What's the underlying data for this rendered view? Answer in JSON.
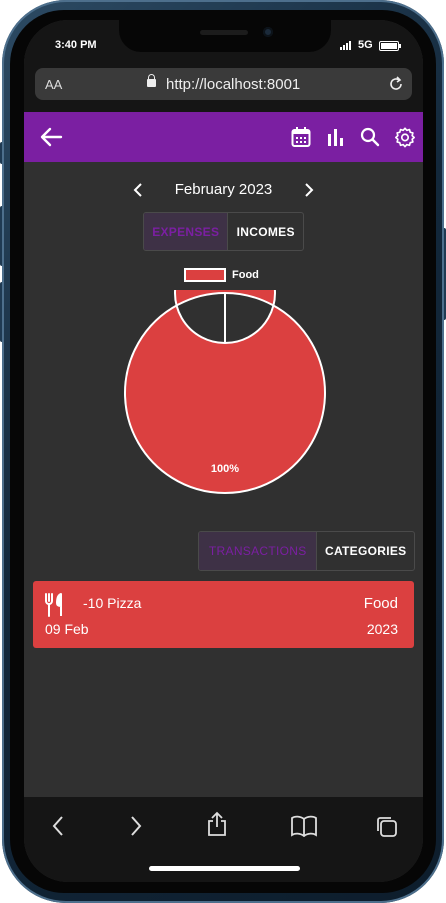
{
  "status": {
    "time": "3:40 PM",
    "network": "5G"
  },
  "browser": {
    "text_size_label": "AA",
    "url": "http://localhost:8001"
  },
  "appbar": {
    "back_icon": "arrow-left-icon",
    "calendar_icon": "calendar-icon",
    "chart_icon": "bar-chart-icon",
    "search_icon": "search-icon",
    "settings_icon": "gear-icon",
    "color": "#7b1fa2"
  },
  "period": {
    "label": "February 2023"
  },
  "type_toggle": {
    "expenses": "EXPENSES",
    "incomes": "INCOMES",
    "active": "expenses"
  },
  "chart_data": {
    "type": "pie",
    "categories": [
      "Food"
    ],
    "values": [
      100
    ],
    "labels": [
      "100%"
    ],
    "colors": [
      "#db4040"
    ],
    "legend": [
      "Food"
    ],
    "legend_position": "top"
  },
  "view_toggle": {
    "transactions": "TRANSACTIONS",
    "categories": "CATEGORIES",
    "active": "transactions"
  },
  "transactions": [
    {
      "icon": "utensils-icon",
      "title": "-10 Pizza",
      "date": "09 Feb",
      "category": "Food",
      "year": "2023",
      "color": "#db4040"
    }
  ],
  "bottom_bar": [
    "back-icon",
    "forward-icon",
    "share-icon",
    "bookmarks-icon",
    "tabs-icon"
  ]
}
